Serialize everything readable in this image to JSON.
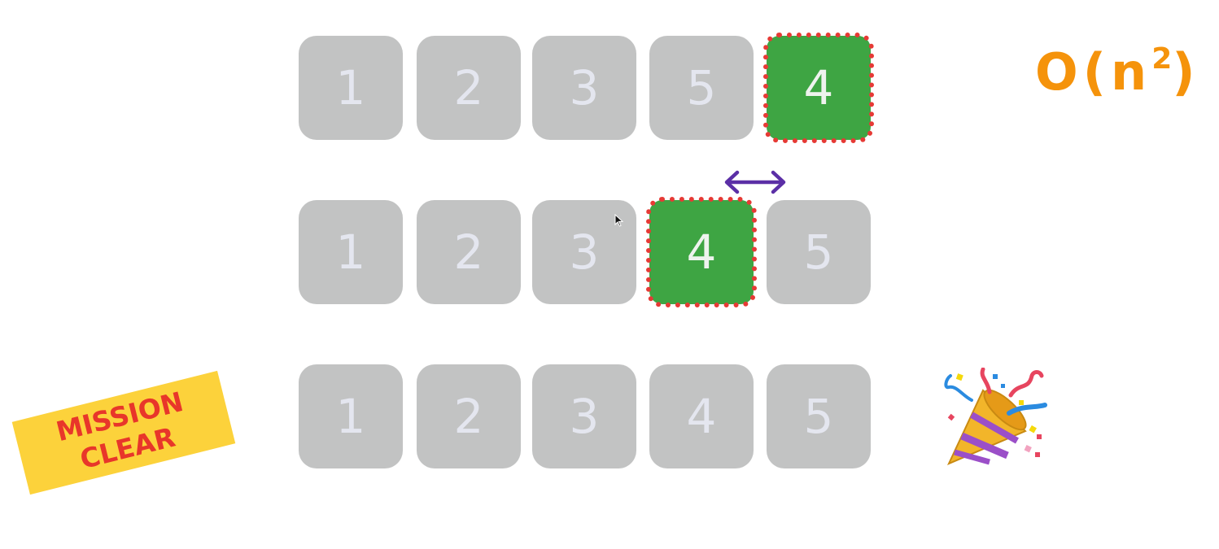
{
  "complexity": {
    "label": "O(n",
    "exponent": "2",
    "close": ")"
  },
  "rows": [
    {
      "tiles": [
        "1",
        "2",
        "3",
        "5",
        "4"
      ],
      "highlight_index": 4
    },
    {
      "tiles": [
        "1",
        "2",
        "3",
        "4",
        "5"
      ],
      "highlight_index": 3
    },
    {
      "tiles": [
        "1",
        "2",
        "3",
        "4",
        "5"
      ],
      "highlight_index": null
    }
  ],
  "stamp": {
    "line1": "MISSION",
    "line2": "CLEAR"
  },
  "icons": [
    "swap-arrow-icon",
    "cursor-icon",
    "party-popper-icon"
  ],
  "colors": {
    "tile": "#c2c3c3",
    "highlight": "#3ea543",
    "highlight_border": "#e63a35",
    "complexity": "#f5930b",
    "stamp_bg": "#fcd23b",
    "stamp_text": "#e8362a",
    "arrow": "#5b2fa6"
  }
}
